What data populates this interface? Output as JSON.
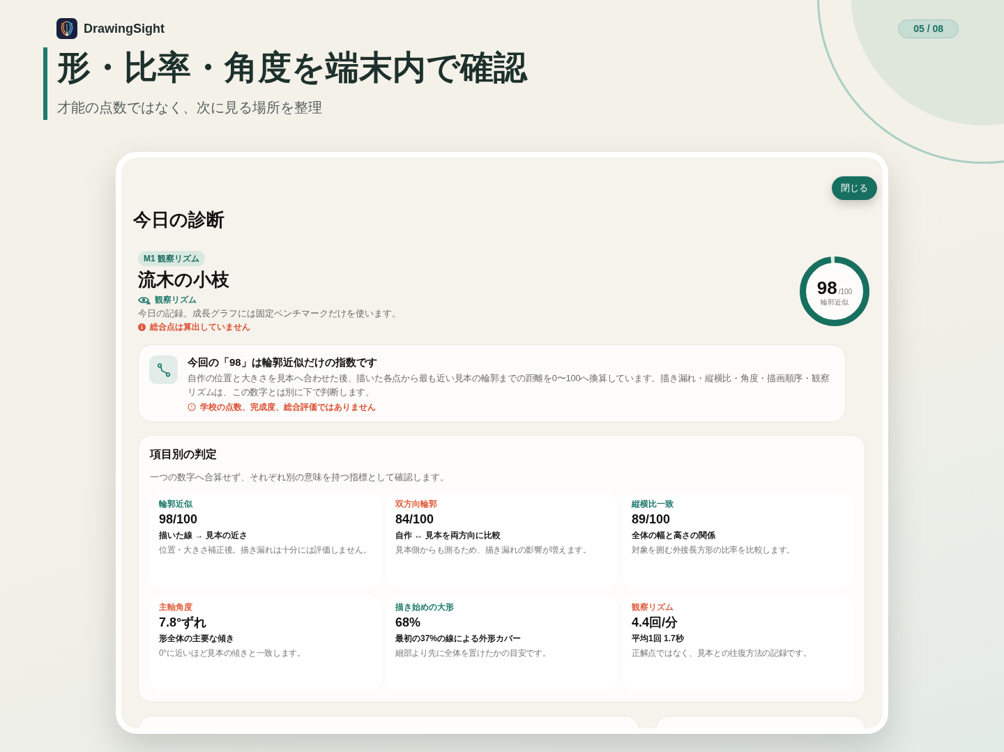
{
  "header": {
    "app_name": "DrawingSight",
    "page_indicator": "05 / 08",
    "title": "形・比率・角度を端末内で確認",
    "subtitle": "才能の点数ではなく、次に見る場所を整理"
  },
  "screen": {
    "close_button": "閉じる",
    "heading": "今日の診断",
    "lesson": {
      "tag": "M1 観察リズム",
      "title": "流木の小枝",
      "category": "観察リズム",
      "description": "今日の記録。成長グラフには固定ベンチマークだけを使います。",
      "warning": "総合点は算出していません"
    },
    "score": {
      "value": "98",
      "max": "/100",
      "label": "輪郭近似",
      "level": 0.98
    },
    "notice": {
      "title": "今回の「98」は輪郭近似だけの指数です",
      "body": "自作の位置と大きさを見本へ合わせた後、描いた各点から最も近い見本の輪郭までの距離を0〜100へ換算しています。描き漏れ・縦横比・角度・描画順序・観察リズムは、この数字とは別に下で判断します。",
      "warning": "学校の点数、完成度、総合評価ではありません"
    },
    "metrics": {
      "title": "項目別の判定",
      "description": "一つの数字へ合算せず、それぞれ別の意味を持つ指標として確認します。",
      "items": [
        {
          "label": "輪郭近似",
          "color": "#1f7a6c",
          "value": "98/100",
          "summary": "描いた線 → 見本の近さ",
          "note": "位置・大きさ補正後。描き漏れは十分には評価しません。"
        },
        {
          "label": "双方向輪郭",
          "color": "#e0603f",
          "value": "84/100",
          "summary": "自作 ↔ 見本を両方向に比較",
          "note": "見本側からも測るため、描き漏れの影響が増えます。"
        },
        {
          "label": "縦横比一致",
          "color": "#1f7a6c",
          "value": "89/100",
          "summary": "全体の幅と高さの関係",
          "note": "対象を囲む外接長方形の比率を比較します。"
        },
        {
          "label": "主軸角度",
          "color": "#e0603f",
          "value": "7.8°ずれ",
          "summary": "形全体の主要な傾き",
          "note": "0°に近いほど見本の傾きと一致します。"
        },
        {
          "label": "描き始めの大形",
          "color": "#1f7a6c",
          "value": "68%",
          "summary": "最初の37%の線による外形カバー",
          "note": "細部より先に全体を置けたかの目安です。"
        },
        {
          "label": "観察リズム",
          "color": "#e0603f",
          "value": "4.4回/分",
          "summary": "平均1回 1.7秒",
          "note": "正解点ではなく、見本との往復方法の記録です。"
        }
      ]
    }
  }
}
